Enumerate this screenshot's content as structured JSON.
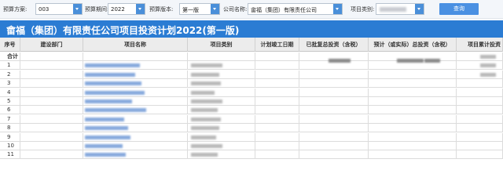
{
  "filters": {
    "plan_label": "预算方案:",
    "plan_value": "003",
    "period_label": "预算期间:",
    "period_value": "2022",
    "version_label": "预算版本:",
    "version_value": "第一版",
    "company_label": "公司名称:",
    "company_value": "畲福（集团）有限责任公司",
    "category_label": "项目类别:",
    "category_value": "",
    "query_label": "查询"
  },
  "title": "畲福（集团）有限责任公司项目投资计划2022(第一版)",
  "table": {
    "columns": [
      "序号",
      "建设部门",
      "项目名称",
      "项目类别",
      "计划竣工日期",
      "已批复总投资（含税）",
      "预计（或实际）总投资（含税）",
      "项目累计投资"
    ],
    "total_label": "合计",
    "rows": [
      "1",
      "2",
      "3",
      "4",
      "5",
      "6",
      "7",
      "8",
      "9",
      "10",
      "11"
    ]
  },
  "colors": {
    "title_bg": "#2b7cd3",
    "query_button": "#4a90e2",
    "select_arrow": "#4a8fd9",
    "header_bg": "#ececec"
  }
}
